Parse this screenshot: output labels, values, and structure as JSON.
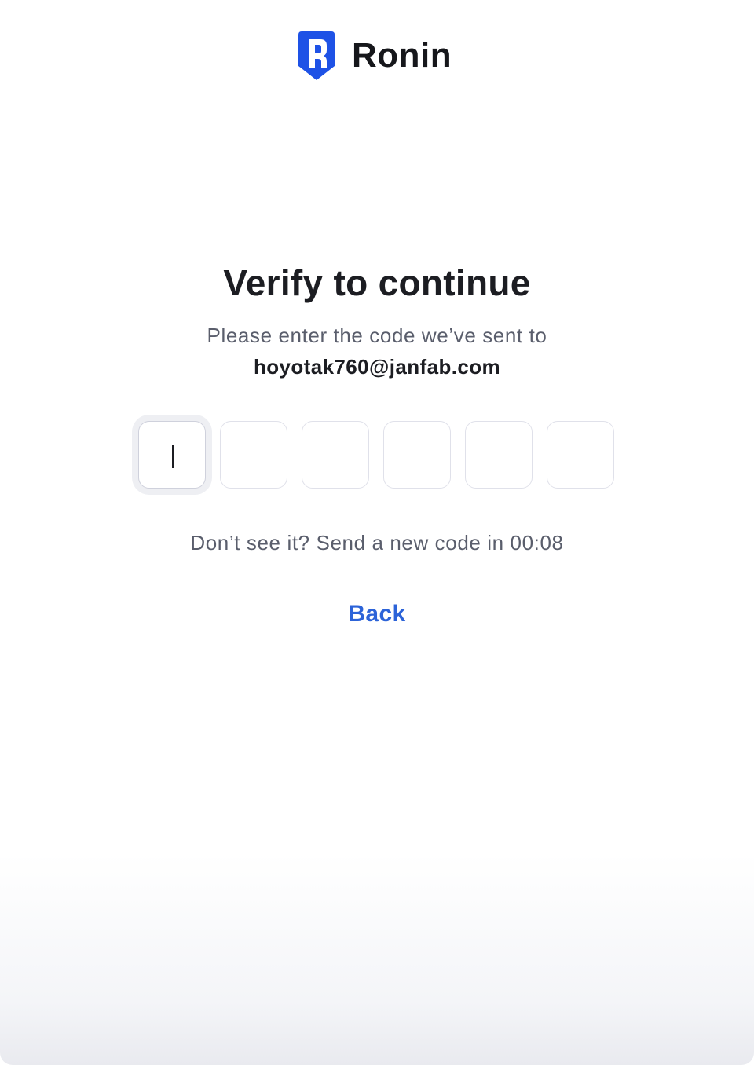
{
  "brand": {
    "name": "Ronin",
    "icon": "ronin-shield-icon",
    "color": "#1e52e6"
  },
  "verify": {
    "title": "Verify to continue",
    "subtitle": "Please enter the code we’ve sent to",
    "email": "hoyotak760@janfab.com"
  },
  "code": {
    "digits": [
      "",
      "",
      "",
      "",
      "",
      ""
    ],
    "active_index": 0
  },
  "resend": {
    "text": "Don’t see it? Send a new code in 00:08"
  },
  "actions": {
    "back_label": "Back",
    "link_color": "#2c63d8"
  }
}
